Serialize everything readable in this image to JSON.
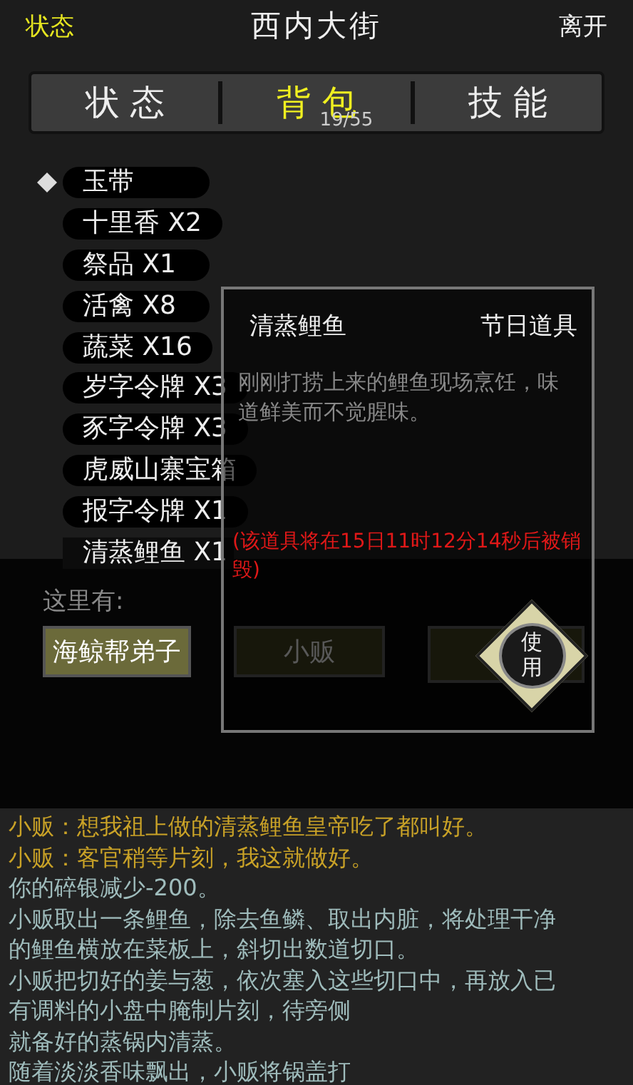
{
  "top_bar": {
    "status_link": "状态",
    "title": "西内大街",
    "leave_link": "离开"
  },
  "tabs": [
    {
      "label": "状 态",
      "selected": false
    },
    {
      "label": "背 包",
      "selected": true,
      "count": "19/55"
    },
    {
      "label": "技 能",
      "selected": false
    }
  ],
  "items": [
    {
      "label": "玉带",
      "selected": false,
      "marked": true
    },
    {
      "label": "十里香 X2",
      "selected": false,
      "marked": false
    },
    {
      "label": "祭品 X1",
      "selected": false,
      "marked": false
    },
    {
      "label": "活禽 X8",
      "selected": false,
      "marked": false
    },
    {
      "label": "蔬菜 X16",
      "selected": false,
      "marked": false
    },
    {
      "label": "岁字令牌 X3",
      "selected": false,
      "marked": false
    },
    {
      "label": "豕字令牌 X3",
      "selected": false,
      "marked": false
    },
    {
      "label": "虎威山寨宝箱",
      "selected": false,
      "marked": false
    },
    {
      "label": "报字令牌 X1",
      "selected": false,
      "marked": false
    },
    {
      "label": "清蒸鲤鱼 X1",
      "selected": true,
      "marked": false
    }
  ],
  "popup": {
    "name": "清蒸鲤鱼",
    "category": "节日道具",
    "description": "刚刚打捞上来的鲤鱼现场烹饪，味道鲜美而不觉腥味。",
    "warning": "(该道具将在15日11时12分14秒后被销毁)",
    "use_button": "使用"
  },
  "here": {
    "label": "这里有:",
    "npcs": [
      {
        "label": "海鲸帮弟子",
        "kind": "text"
      },
      {
        "label": "小贩",
        "kind": "text"
      },
      {
        "kind": "blank"
      }
    ]
  },
  "log": [
    {
      "kind": "speech",
      "lines": [
        "小贩：想我祖上做的清蒸鲤鱼皇帝吃了都叫好。"
      ]
    },
    {
      "kind": "speech",
      "lines": [
        "小贩：客官稍等片刻，我这就做好。"
      ]
    },
    {
      "kind": "narration",
      "lines": [
        "你的碎银减少-200。"
      ]
    },
    {
      "kind": "narration",
      "lines": [
        "小贩取出一条鲤鱼，除去鱼鳞、取出内脏，将处理干净",
        "的鲤鱼横放在菜板上，斜切出数道切口。"
      ]
    },
    {
      "kind": "narration",
      "lines": [
        "小贩把切好的姜与葱，依次塞入这些切口中，再放入已",
        "有调料的小盘中腌制片刻，待旁侧",
        "就备好的蒸锅内清蒸。"
      ]
    },
    {
      "kind": "narration",
      "lines": [
        "随着淡淡香味飘出，小贩将锅盖打"
      ]
    }
  ]
}
